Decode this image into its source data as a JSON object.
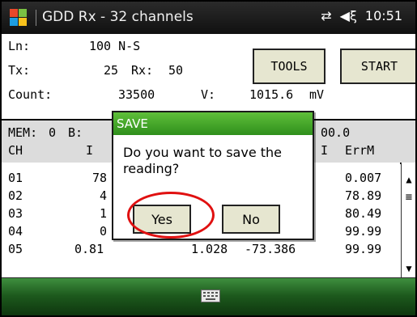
{
  "titlebar": {
    "title": "GDD Rx - 32 channels",
    "time": "10:51",
    "network_icon": "network-icon",
    "volume_icon": "volume-icon"
  },
  "form": {
    "ln_label": "Ln:",
    "ln_value": "100 N-S",
    "tx_label": "Tx:",
    "tx_value": "25",
    "rx_label": "Rx:",
    "rx_value": "50",
    "count_label": "Count:",
    "count_value": "33500",
    "v_label": "V:",
    "v_value": "1015.6",
    "v_unit": "mV",
    "tools_button": "TOOLS",
    "start_button": "START"
  },
  "table": {
    "mem_label": "MEM:",
    "mem_value": "0",
    "b_label": "B:",
    "right_value": "00.0",
    "columns": {
      "ch": "CH",
      "i": "I",
      "i2": "I",
      "errm": "ErrM"
    },
    "rows": [
      {
        "ch": "01",
        "v1": "78",
        "v2": "",
        "v3": "",
        "errm": "0.007"
      },
      {
        "ch": "02",
        "v1": "4",
        "v2": "",
        "v3": "",
        "errm": "78.89"
      },
      {
        "ch": "03",
        "v1": "1",
        "v2": "",
        "v3": "",
        "errm": "80.49"
      },
      {
        "ch": "04",
        "v1": "0",
        "v2": "",
        "v3": "",
        "errm": "99.99"
      },
      {
        "ch": "05",
        "v1": "0.81",
        "v2": "1.028",
        "v3": "-73.386",
        "errm": "99.99"
      }
    ]
  },
  "dialog": {
    "title": "SAVE",
    "message": "Do you want to save the reading?",
    "yes_label": "Yes",
    "no_label": "No"
  },
  "colors": {
    "dialog_title": "#3fa52a",
    "highlight_ring": "#e01010",
    "button_bg": "#e6e6d0"
  }
}
